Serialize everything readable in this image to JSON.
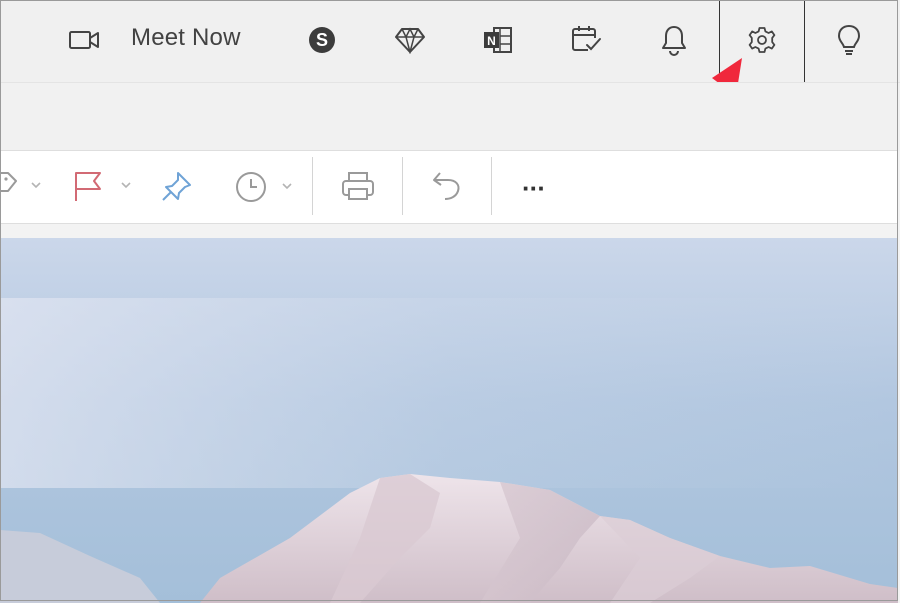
{
  "topbar": {
    "meet_now_label": "Meet Now",
    "icons": [
      "video-camera-icon",
      "skype-icon",
      "diamond-icon",
      "onenote-icon",
      "calendar-check-icon",
      "bell-icon",
      "gear-icon",
      "lightbulb-icon"
    ]
  },
  "toolbar": {
    "icons": [
      "tag-icon",
      "flag-icon",
      "pin-icon",
      "clock-icon",
      "printer-icon",
      "undo-icon",
      "more-options-icon"
    ],
    "more_label": "···"
  },
  "colors": {
    "accent_arrow": "#f0283c",
    "flag": "#d26a74",
    "pin": "#6fa3d6",
    "topbar_bg": "#f0f0f0"
  },
  "annotation": {
    "highlight_target": "gear-icon"
  }
}
